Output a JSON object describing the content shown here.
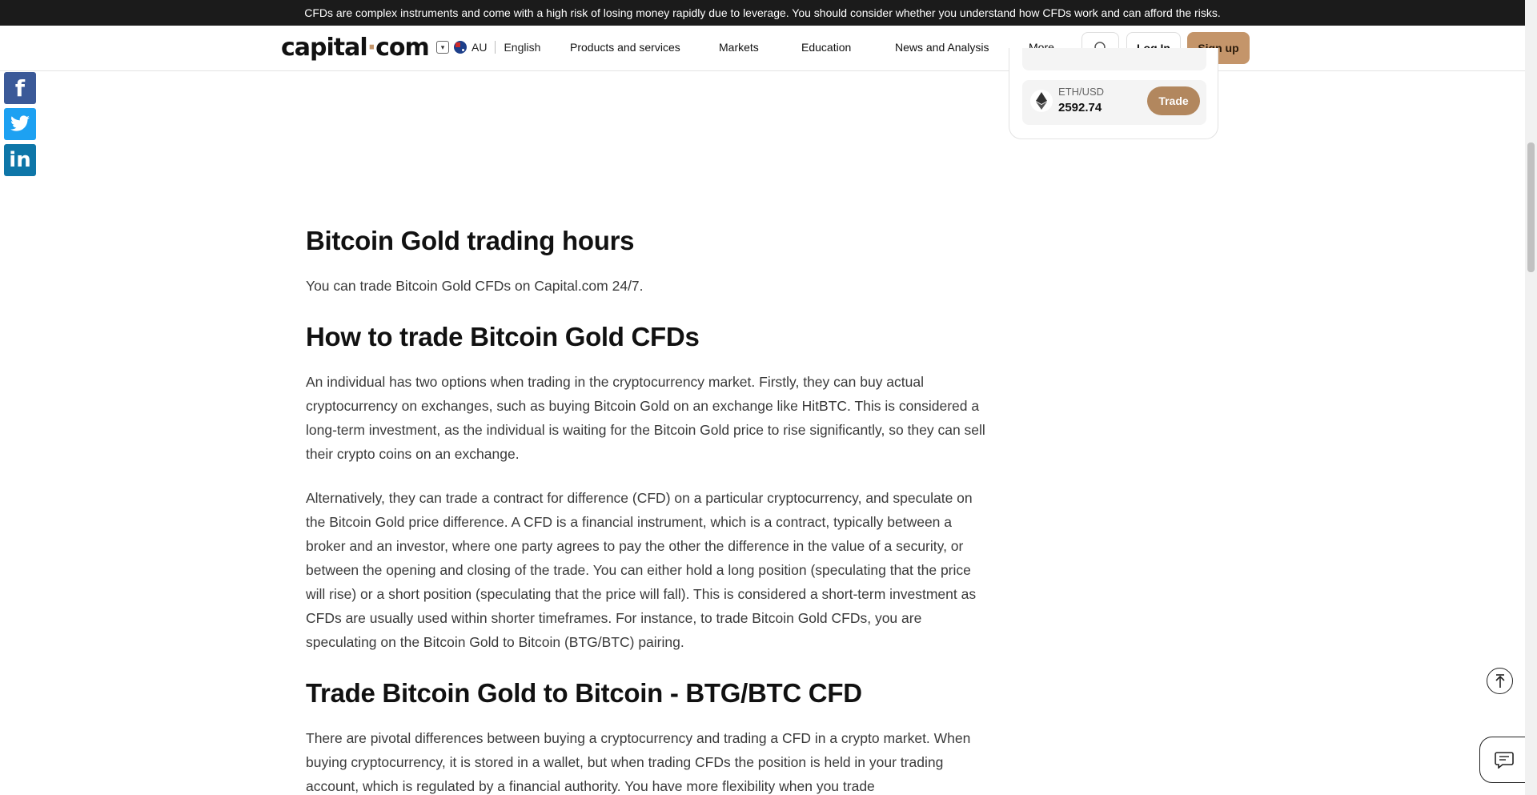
{
  "risk_banner": {
    "text": "CFDs are complex instruments and come with a high risk of losing money rapidly due to leverage. You should consider whether you understand how CFDs work and can afford the risks."
  },
  "header": {
    "logo_part1": "capital",
    "logo_dot": "·",
    "logo_part2": "com",
    "region": "AU",
    "language": "English",
    "nav": [
      {
        "label": "Products and services"
      },
      {
        "label": "Markets"
      },
      {
        "label": "Education"
      },
      {
        "label": "News and Analysis"
      },
      {
        "label": "More"
      }
    ],
    "login_label": "Log In",
    "signup_label": "Sign up"
  },
  "social": {
    "facebook": "f",
    "twitter": "t",
    "linkedin": "in"
  },
  "widget": {
    "pair": "ETH/USD",
    "price": "2592.74",
    "trade_label": "Trade"
  },
  "article": {
    "heading1": "Bitcoin Gold trading hours",
    "para1": "You can trade Bitcoin Gold CFDs on Capital.com 24/7.",
    "heading2": "How to trade Bitcoin Gold CFDs",
    "para2": "An individual has two options when trading in the cryptocurrency market. Firstly, they can buy actual cryptocurrency on exchanges, such as buying Bitcoin Gold on an exchange like HitBTC. This is considered a long-term investment, as the individual is waiting for the Bitcoin Gold price to rise significantly, so they can sell their crypto coins on an exchange.",
    "para3": "Alternatively, they can trade a contract for difference (CFD) on a particular cryptocurrency, and speculate on the Bitcoin Gold price difference. A CFD is a financial instrument, which is a contract, typically between a broker and an investor, where one party agrees to pay the other the difference in the value of a security, or between the opening and closing of the trade. You can either hold a long position (speculating that the price will rise) or a short position (speculating that the price will fall). This is considered a short-term investment as CFDs are usually used within shorter timeframes. For instance, to trade Bitcoin Gold CFDs, you are speculating on the Bitcoin Gold to Bitcoin (BTG/BTC) pairing.",
    "heading3": "Trade Bitcoin Gold to Bitcoin - BTG/BTC CFD",
    "para4": "There are pivotal differences between buying a cryptocurrency and trading a CFD in a crypto market. When buying cryptocurrency, it is stored in a wallet, but when trading CFDs the position  is held in your trading account, which is regulated by a financial authority. You have more flexibility when you trade"
  },
  "colors": {
    "accent": "#c4956a",
    "banner_bg": "#1b1b1b",
    "facebook": "#3b5998",
    "twitter": "#1da1f2",
    "linkedin": "#0e76a8"
  }
}
